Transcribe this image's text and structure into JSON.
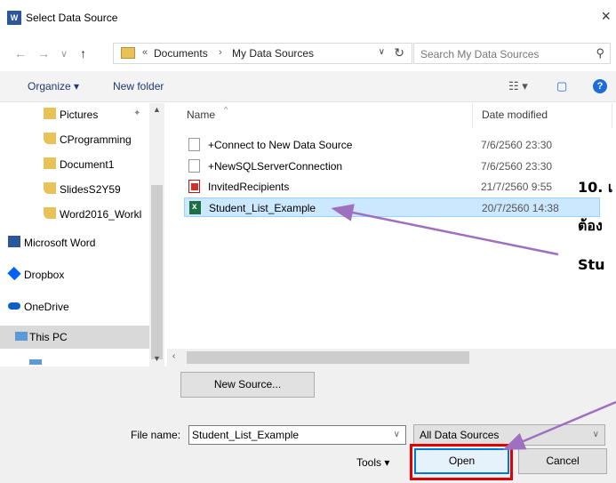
{
  "window": {
    "title": "Select Data Source",
    "app_icon": "W",
    "close_glyph": "×"
  },
  "nav": {
    "back_glyph": "←",
    "forward_glyph": "→",
    "recent_glyph": "∨",
    "up_glyph": "↑",
    "address": {
      "prefix": "«",
      "crumbs": [
        "Documents",
        "My Data Sources"
      ],
      "separator": "›",
      "dropdown_glyph": "∨",
      "refresh_glyph": "↻"
    },
    "search_placeholder": "Search My Data Sources",
    "search_glyph": "⚲"
  },
  "commands": {
    "organize": "Organize ▾",
    "new_folder": "New folder",
    "view_glyph": "☷ ▾",
    "pane_glyph": "▢",
    "help_glyph": "?"
  },
  "sidebar": {
    "items": [
      {
        "label": "Pictures",
        "icon": "pictures-folder-icon",
        "pin": "📌"
      },
      {
        "label": "CProgramming",
        "icon": "onedrive-folder-icon"
      },
      {
        "label": "Document1",
        "icon": "folder-icon"
      },
      {
        "label": "SlidesS2Y59",
        "icon": "onedrive-folder-icon"
      },
      {
        "label": "Word2016_Workl",
        "icon": "onedrive-folder-icon"
      },
      {
        "label": "Microsoft Word",
        "icon": "word-icon"
      },
      {
        "label": "Dropbox",
        "icon": "dropbox-icon"
      },
      {
        "label": "OneDrive",
        "icon": "onedrive-icon"
      },
      {
        "label": "This PC",
        "icon": "pc-icon"
      }
    ],
    "selected": "This PC"
  },
  "files": {
    "columns": {
      "name": "Name",
      "date": "Date modified"
    },
    "rows": [
      {
        "name": "+Connect to New Data Source",
        "date": "7/6/2560 23:30",
        "type": "blank"
      },
      {
        "name": "+NewSQLServerConnection",
        "date": "7/6/2560 23:30",
        "type": "blank"
      },
      {
        "name": "InvitedRecipients",
        "date": "21/7/2560 9:55",
        "type": "pdf"
      },
      {
        "name": "Student_List_Example",
        "date": "20/7/2560 14:38",
        "type": "xls",
        "selected": true
      }
    ]
  },
  "bottom": {
    "new_source": "New Source...",
    "file_name_label": "File name:",
    "file_name_value": "Student_List_Example",
    "filter_value": "All Data Sources",
    "tools": "Tools ▾",
    "open": "Open",
    "cancel": "Cancel"
  },
  "annotation": {
    "line1": "10. เ",
    "line2": "ต้อง",
    "line3": "Stu",
    "arrow_color": "#a070c0",
    "box_color": "#e00000"
  }
}
